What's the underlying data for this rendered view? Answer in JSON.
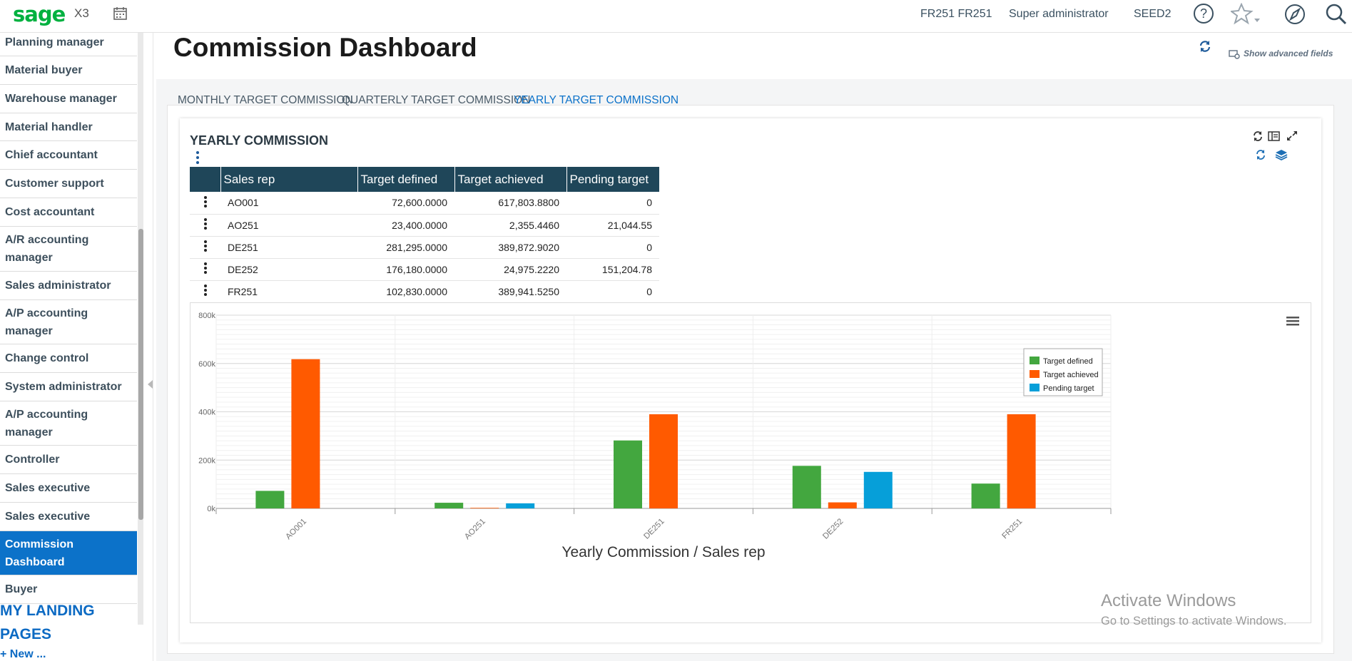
{
  "topbar": {
    "logo": "sage",
    "product": "X3",
    "user_code": "FR251 FR251",
    "role": "Super administrator",
    "folder": "SEED2"
  },
  "sidebar": {
    "items": [
      {
        "label": "Planning manager",
        "active": false
      },
      {
        "label": "Material buyer",
        "active": false
      },
      {
        "label": "Warehouse manager",
        "active": false
      },
      {
        "label": "Material handler",
        "active": false
      },
      {
        "label": "Chief accountant",
        "active": false
      },
      {
        "label": "Customer support",
        "active": false
      },
      {
        "label": "Cost accountant",
        "active": false
      },
      {
        "label": "A/R accounting manager",
        "active": false
      },
      {
        "label": "Sales administrator",
        "active": false
      },
      {
        "label": "A/P accounting manager",
        "active": false
      },
      {
        "label": "Change control",
        "active": false
      },
      {
        "label": "System administrator",
        "active": false
      },
      {
        "label": "A/P accounting manager",
        "active": false
      },
      {
        "label": "Controller",
        "active": false
      },
      {
        "label": "Sales executive",
        "active": false
      },
      {
        "label": "Sales executive",
        "active": false
      },
      {
        "label": "Commission Dashboard",
        "active": true
      },
      {
        "label": "Buyer",
        "active": false
      }
    ],
    "landing_title": "MY LANDING PAGES",
    "new_link": "+ New ..."
  },
  "page": {
    "title": "Commission Dashboard",
    "advanced_fields": "Show advanced fields",
    "tabs": [
      {
        "label": "MONTHLY TARGET COMMISSION",
        "active": false
      },
      {
        "label": "QUARTERLY TARGET COMMISSION",
        "active": false
      },
      {
        "label": "YEARLY TARGET COMMISSION",
        "active": true
      }
    ]
  },
  "card": {
    "title": "YEARLY COMMISSION",
    "columns": [
      "Sales rep",
      "Target defined",
      "Target achieved",
      "Pending target"
    ],
    "rows": [
      [
        "AO001",
        "72,600.0000",
        "617,803.8800",
        "0"
      ],
      [
        "AO251",
        "23,400.0000",
        "2,355.4460",
        "21,044.55"
      ],
      [
        "DE251",
        "281,295.0000",
        "389,872.9020",
        "0"
      ],
      [
        "DE252",
        "176,180.0000",
        "24,975.2220",
        "151,204.78"
      ],
      [
        "FR251",
        "102,830.0000",
        "389,941.5250",
        "0"
      ]
    ]
  },
  "chart_data": {
    "type": "bar",
    "categories": [
      "AO001",
      "AO251",
      "DE251",
      "DE252",
      "FR251"
    ],
    "series": [
      {
        "name": "Target defined",
        "color": "#43a73f",
        "values": [
          72600,
          23400,
          281295,
          176180,
          102830
        ]
      },
      {
        "name": "Target achieved",
        "color": "#ff5a00",
        "values": [
          617803.88,
          2355.446,
          389872.902,
          24975.222,
          389941.525
        ]
      },
      {
        "name": "Pending target",
        "color": "#069fd9",
        "values": [
          0,
          21044.55,
          0,
          151204.78,
          0
        ]
      }
    ],
    "yticks": [
      "0k",
      "200k",
      "400k",
      "600k",
      "800k"
    ],
    "ylim": [
      0,
      800000
    ],
    "xlabel": "Yearly Commission / Sales rep",
    "legend": "right"
  },
  "watermark": {
    "line1": "Activate Windows",
    "line2": "Go to Settings to activate Windows."
  }
}
